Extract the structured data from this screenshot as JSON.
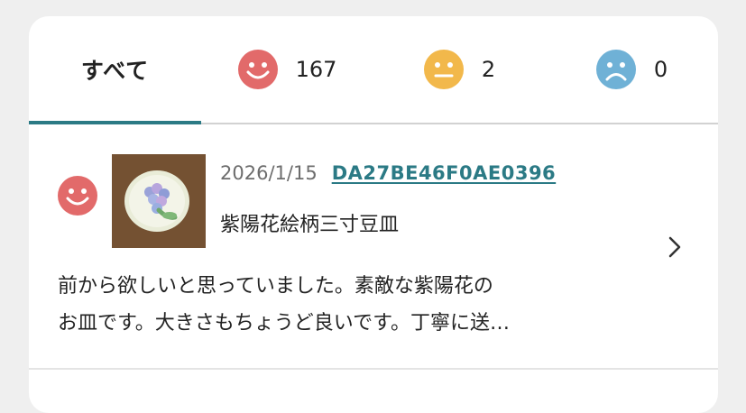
{
  "tabs": {
    "all_label": "すべて",
    "good_count": "167",
    "normal_count": "2",
    "bad_count": "0"
  },
  "colors": {
    "good": "#e26a6a",
    "normal": "#f2b84b",
    "bad": "#6fb1d6",
    "accent": "#2b7a85"
  },
  "review": {
    "rating_icon": "good-face-icon",
    "date": "2026/1/15",
    "order_id": "DA27BE46F0AE0396",
    "product_name": "紫陽花絵柄三寸豆皿",
    "comment_line1": "前から欲しいと思っていました。素敵な紫陽花の",
    "comment_line2": "お皿です。大きさもちょうど良いです。丁寧に送…"
  }
}
